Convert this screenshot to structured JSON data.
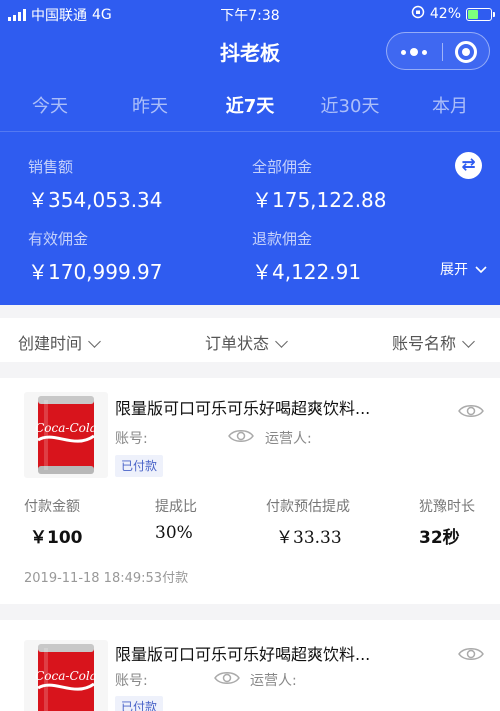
{
  "status_bar": {
    "carrier": "中国联通",
    "network": "4G",
    "time": "下午7:38",
    "battery": "42%"
  },
  "app": {
    "title": "抖老板"
  },
  "tabs": [
    {
      "label": "今天",
      "active": false
    },
    {
      "label": "昨天",
      "active": false
    },
    {
      "label": "近7天",
      "active": true
    },
    {
      "label": "近30天",
      "active": false
    },
    {
      "label": "本月",
      "active": false
    }
  ],
  "stats": {
    "sales_label": "销售额",
    "sales_value": "￥354,053.34",
    "commission_label": "全部佣金",
    "commission_value": "￥175,122.88",
    "valid_label": "有效佣金",
    "valid_value": "￥170,999.97",
    "refund_label": "退款佣金",
    "refund_value": "￥4,122.91",
    "expand_label": "展开"
  },
  "filters": [
    {
      "label": "创建时间"
    },
    {
      "label": "订单状态"
    },
    {
      "label": "账号名称"
    }
  ],
  "orders": [
    {
      "title": "限量版可口可乐可乐好喝超爽饮料...",
      "account_label": "账号:",
      "operator_label": "运营人:",
      "status": "已付款",
      "metrics": {
        "amount_label": "付款金额",
        "amount_value": "￥100",
        "rate_label": "提成比",
        "rate_value": "30%",
        "estimate_label": "付款预估提成",
        "estimate_value": "￥33.33",
        "hesitate_label": "犹豫时长",
        "hesitate_value": "32秒"
      },
      "date": "2019-11-18 18:49:53付款"
    },
    {
      "title": "限量版可口可乐可乐好喝超爽饮料...",
      "account_label": "账号:",
      "operator_label": "运营人:",
      "status": "已付款"
    }
  ],
  "colors": {
    "header_blue": "#2f5cf0",
    "coke_red": "#d8141c"
  }
}
